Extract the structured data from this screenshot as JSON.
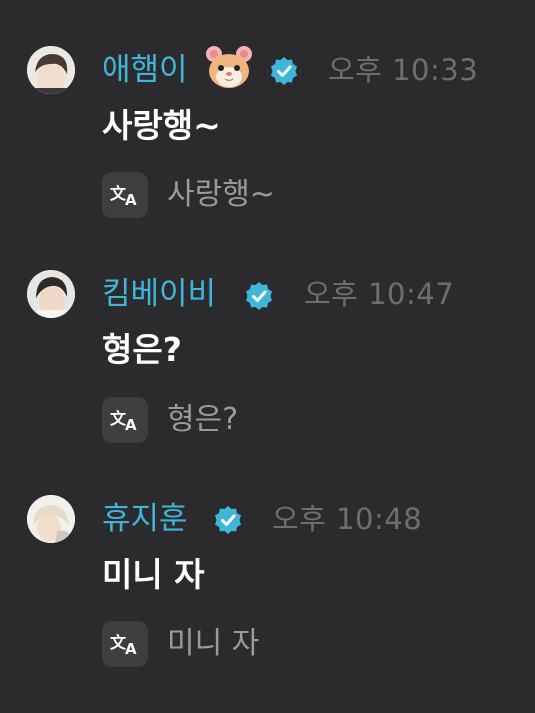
{
  "messages": [
    {
      "username": "애햄이",
      "has_hamster_emoji": true,
      "verified": true,
      "time": "오후 10:33",
      "text": "사랑행~",
      "translation": "사랑행~"
    },
    {
      "username": "킴베이비",
      "has_hamster_emoji": false,
      "verified": true,
      "time": "오후 10:47",
      "text": "형은?",
      "translation": "형은?"
    },
    {
      "username": "휴지훈",
      "has_hamster_emoji": false,
      "verified": true,
      "time": "오후 10:48",
      "text": "미니 자",
      "translation": "미니 자"
    }
  ],
  "colors": {
    "background": "#2b2b2d",
    "username": "#3fb6d9",
    "verified_badge": "#3fb6d9",
    "message_text": "#ffffff",
    "timestamp": "#6e6e72",
    "translation_text": "#9a9a9e",
    "translate_button_bg": "#3e3e41"
  },
  "icons": {
    "verified": "verified-badge-icon",
    "translate": "translate-icon",
    "emoji": "hamster-emoji"
  }
}
